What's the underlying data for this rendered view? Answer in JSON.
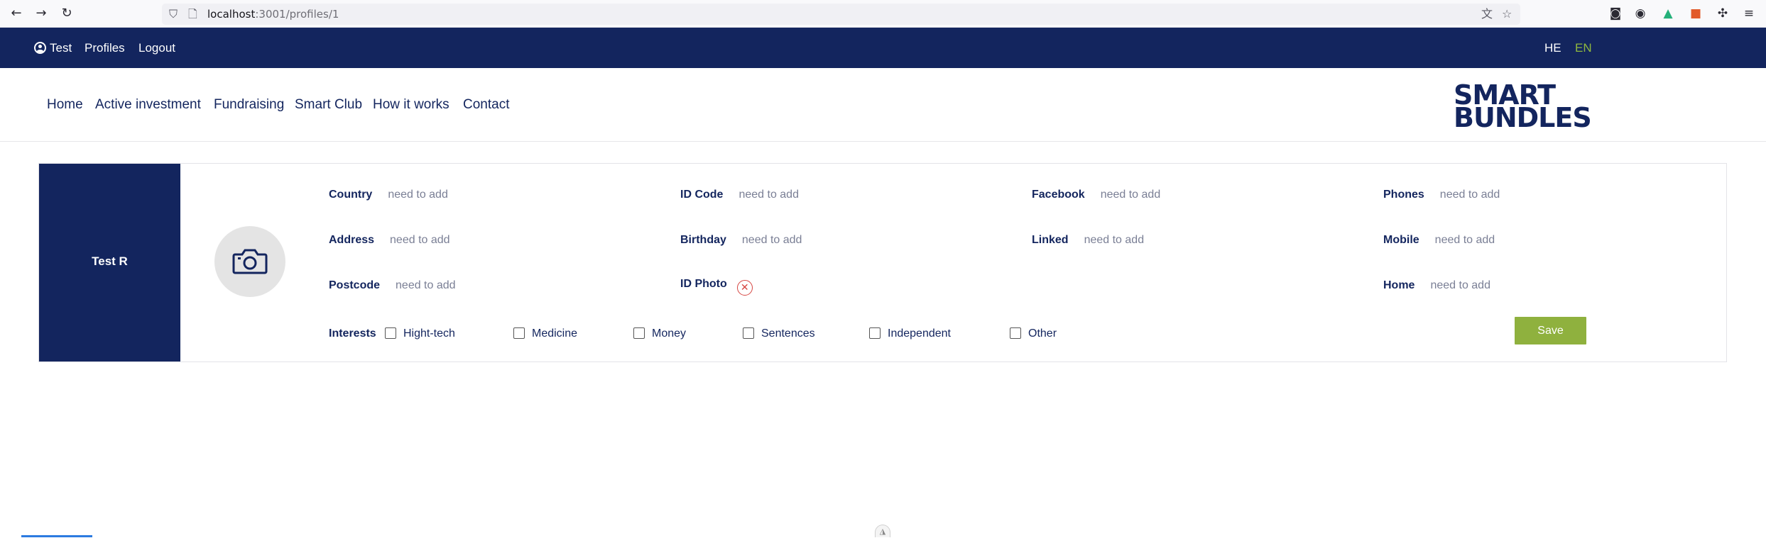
{
  "browser": {
    "url_host": "localhost",
    "url_rest": ":3001/profiles/1"
  },
  "topbar": {
    "user": "Test",
    "profiles": "Profiles",
    "logout": "Logout",
    "lang_he": "HE",
    "lang_en": "EN",
    "lang_en_color": "#8fb73e"
  },
  "nav": {
    "home": "Home",
    "active_investment": "Active investment",
    "fundraising": "Fundraising",
    "smart_club": "Smart Club",
    "how_it_works": "How it works",
    "contact": "Contact",
    "logo_line1": "SMART",
    "logo_line2": "BUNDLES"
  },
  "profile": {
    "name": "Test R",
    "fields": {
      "country": {
        "label": "Country",
        "value": "need to add"
      },
      "address": {
        "label": "Address",
        "value": "need to add"
      },
      "postcode": {
        "label": "Postcode",
        "value": "need to add"
      },
      "id_code": {
        "label": "ID Code",
        "value": "need to add"
      },
      "birthday": {
        "label": "Birthday",
        "value": "need to add"
      },
      "id_photo": {
        "label": "ID Photo"
      },
      "facebook": {
        "label": "Facebook",
        "value": "need to add"
      },
      "linked": {
        "label": "Linked",
        "value": "need to add"
      },
      "phones": {
        "label": "Phones",
        "value": "need to add"
      },
      "mobile": {
        "label": "Mobile",
        "value": "need to add"
      },
      "home": {
        "label": "Home",
        "value": "need to add"
      }
    },
    "interests_label": "Interests",
    "interests": [
      {
        "label": "Hight-tech",
        "checked": false
      },
      {
        "label": "Medicine",
        "checked": false
      },
      {
        "label": "Money",
        "checked": false
      },
      {
        "label": "Sentences",
        "checked": false
      },
      {
        "label": "Independent",
        "checked": false
      },
      {
        "label": "Other",
        "checked": false
      }
    ],
    "save_label": "Save"
  },
  "colors": {
    "brand_navy": "#13255e",
    "accent_green": "#8fb13e",
    "error_red": "#d64541"
  }
}
